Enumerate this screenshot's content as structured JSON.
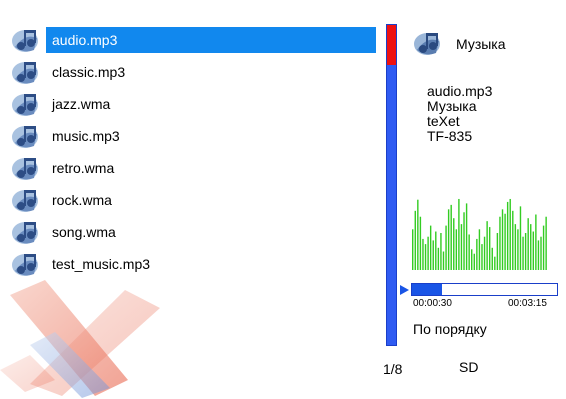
{
  "files": [
    {
      "name": "audio.mp3",
      "selected": true,
      "icon": "music-note-icon"
    },
    {
      "name": "classic.mp3",
      "selected": false,
      "icon": "music-note-icon"
    },
    {
      "name": "jazz.wma",
      "selected": false,
      "icon": "music-note-icon"
    },
    {
      "name": "music.mp3",
      "selected": false,
      "icon": "music-note-icon"
    },
    {
      "name": "retro.wma",
      "selected": false,
      "icon": "music-note-icon"
    },
    {
      "name": "rock.wma",
      "selected": false,
      "icon": "music-note-icon"
    },
    {
      "name": "song.wma",
      "selected": false,
      "icon": "music-note-icon"
    },
    {
      "name": "test_music.mp3",
      "selected": false,
      "icon": "music-note-icon"
    }
  ],
  "scrollbar": {
    "position_fraction": 0.0,
    "visible_fraction": 0.125
  },
  "page_count": "1/8",
  "folder": {
    "title": "Музыка",
    "icon": "music-folder-icon"
  },
  "info": {
    "file": "audio.mp3",
    "folder": "Музыка",
    "artist": "teXet",
    "model": "TF-835"
  },
  "equalizer": {
    "color": "#33cc22",
    "levels": [
      0.55,
      0.8,
      0.95,
      0.72,
      0.42,
      0.35,
      0.45,
      0.6,
      0.4,
      0.52,
      0.3,
      0.5,
      0.25,
      0.6,
      0.82,
      0.88,
      0.7,
      0.55,
      0.96,
      0.62,
      0.78,
      0.9,
      0.48,
      0.28,
      0.22,
      0.42,
      0.55,
      0.35,
      0.45,
      0.66,
      0.58,
      0.3,
      0.18,
      0.5,
      0.72,
      0.82,
      0.76,
      0.92,
      0.96,
      0.8,
      0.62,
      0.55,
      0.86,
      0.45,
      0.5,
      0.7,
      0.62,
      0.52,
      0.75,
      0.4,
      0.45,
      0.6,
      0.72
    ]
  },
  "playback": {
    "icon": "play-icon",
    "elapsed": "00:00:30",
    "total": "00:03:15",
    "progress": 0.21
  },
  "mode": "По порядку",
  "storage": "SD",
  "colors": {
    "accent": "#1188ee",
    "scroll_track": "#2f5bf2",
    "scroll_thumb": "#ee1111",
    "progress_fill": "#1a55e6"
  }
}
